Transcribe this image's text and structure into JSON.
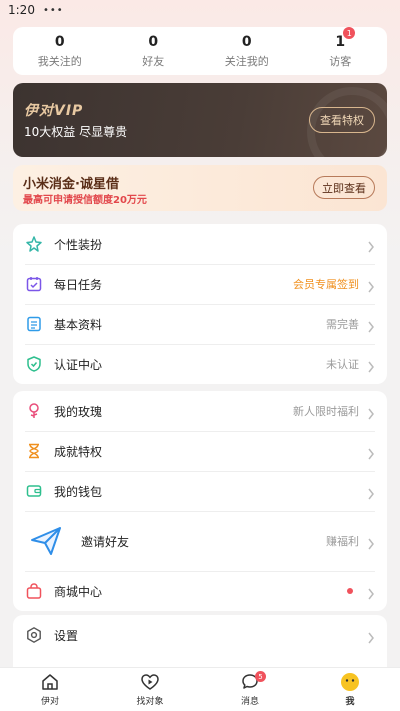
{
  "status_bar": {
    "time": "1:20",
    "dots": "•••"
  },
  "stats": [
    {
      "num": "0",
      "label": "我关注的"
    },
    {
      "num": "0",
      "label": "好友"
    },
    {
      "num": "0",
      "label": "关注我的"
    },
    {
      "num": "1",
      "label": "访客",
      "badge": "1"
    }
  ],
  "vip": {
    "title": "伊对VIP",
    "subtitle": "10大权益 尽显尊贵",
    "button": "查看特权"
  },
  "loan": {
    "title": "小米消金·诚星借",
    "subtitle": "最高可申请授信额度20万元",
    "button": "立即查看"
  },
  "menu_group_1": [
    {
      "label": "个性装扮",
      "right": ""
    },
    {
      "label": "每日任务",
      "right": "会员专属签到"
    },
    {
      "label": "基本资料",
      "right": "需完善"
    },
    {
      "label": "认证中心",
      "right": "未认证"
    }
  ],
  "menu_group_2": [
    {
      "label": "我的玫瑰",
      "right": "新人限时福利"
    },
    {
      "label": "成就特权",
      "right": ""
    },
    {
      "label": "我的钱包",
      "right": ""
    },
    {
      "label": "邀请好友",
      "right": "赚福利"
    },
    {
      "label": "商城中心",
      "right": ""
    }
  ],
  "menu_group_3": [
    {
      "label": "设置",
      "right": ""
    }
  ],
  "tabs": [
    {
      "label": "伊对"
    },
    {
      "label": "找对象"
    },
    {
      "label": "消息",
      "badge": "5"
    },
    {
      "label": "我"
    }
  ],
  "colors": {
    "accent_orange": "#f0901e",
    "badge_red": "#f0525c",
    "vip_gold": "#e8c9a2"
  }
}
